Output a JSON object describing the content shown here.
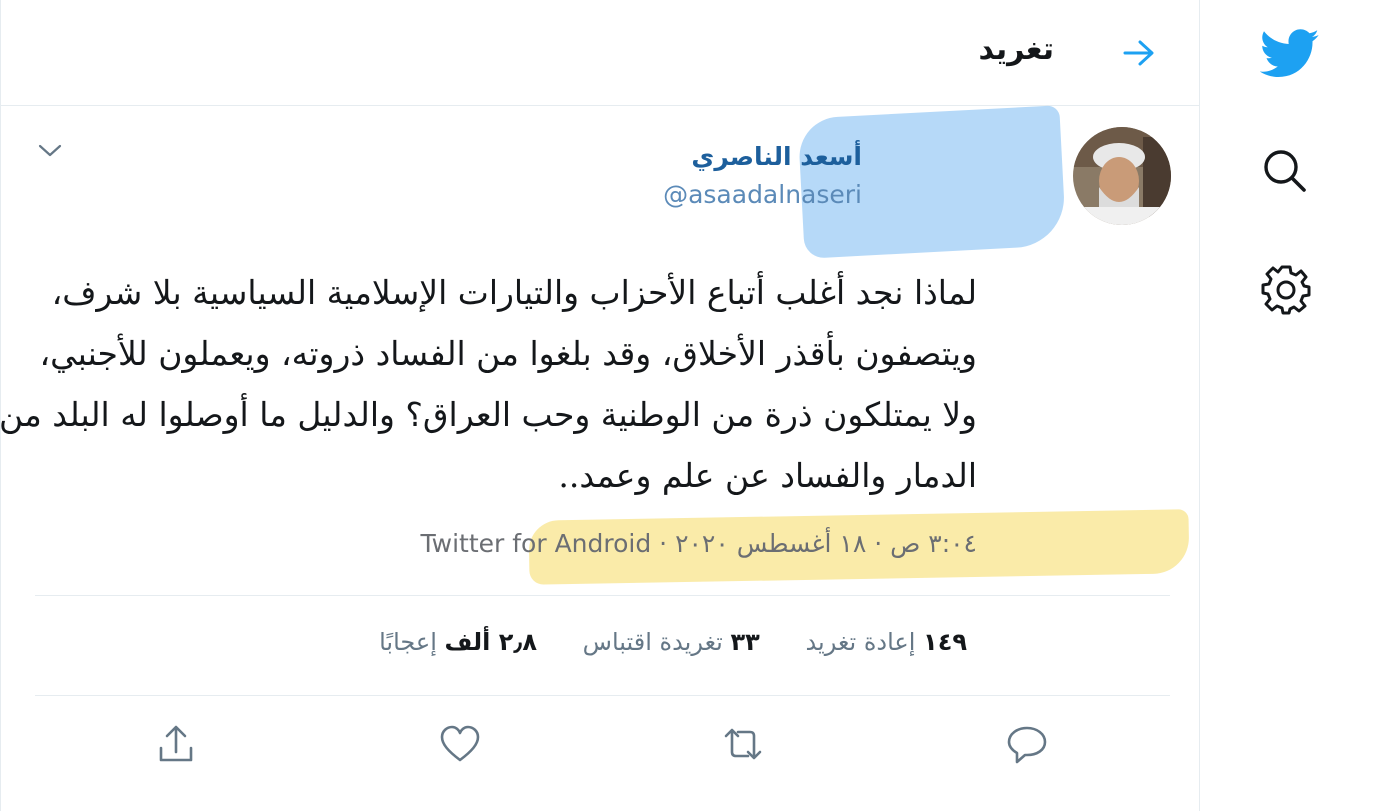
{
  "header": {
    "title": "تغريد"
  },
  "tweet": {
    "author_name": "أسعد الناصري",
    "author_handle": "@asaadalnaseri",
    "text_lines": [
      "لماذا نجد أغلب أتباع الأحزاب والتيارات الإسلامية السياسية بلا شرف،",
      "ويتصفون بأقذر الأخلاق، وقد بلغوا من الفساد ذروته، ويعملون للأجنبي،",
      "ولا يمتلكون ذرة من الوطنية وحب العراق؟ والدليل ما أوصلوا له البلد من",
      "الدمار والفساد عن علم وعمد.."
    ],
    "meta": "٣:٠٤ ص · ١٨ أغسطس ٢٠٢٠ · Twitter for Android"
  },
  "stats": {
    "retweets": {
      "num": "١٤٩",
      "label": "إعادة تغريد"
    },
    "quotes": {
      "num": "٣٣",
      "label": "تغريدة اقتباس"
    },
    "likes": {
      "num": "٢٫٨ ألف",
      "label": "إعجابًا"
    }
  },
  "icons": {
    "logo": "twitter-bird-icon",
    "search": "search-icon",
    "settings": "gear-icon",
    "back": "arrow-icon",
    "caret": "chevron-down-icon",
    "reply": "reply-icon",
    "retweet": "retweet-icon",
    "like": "heart-icon",
    "share": "share-icon"
  },
  "colors": {
    "accent": "#1da1f2",
    "highlight_blue": "#8fc4f4",
    "highlight_yellow": "#f9e79a"
  }
}
